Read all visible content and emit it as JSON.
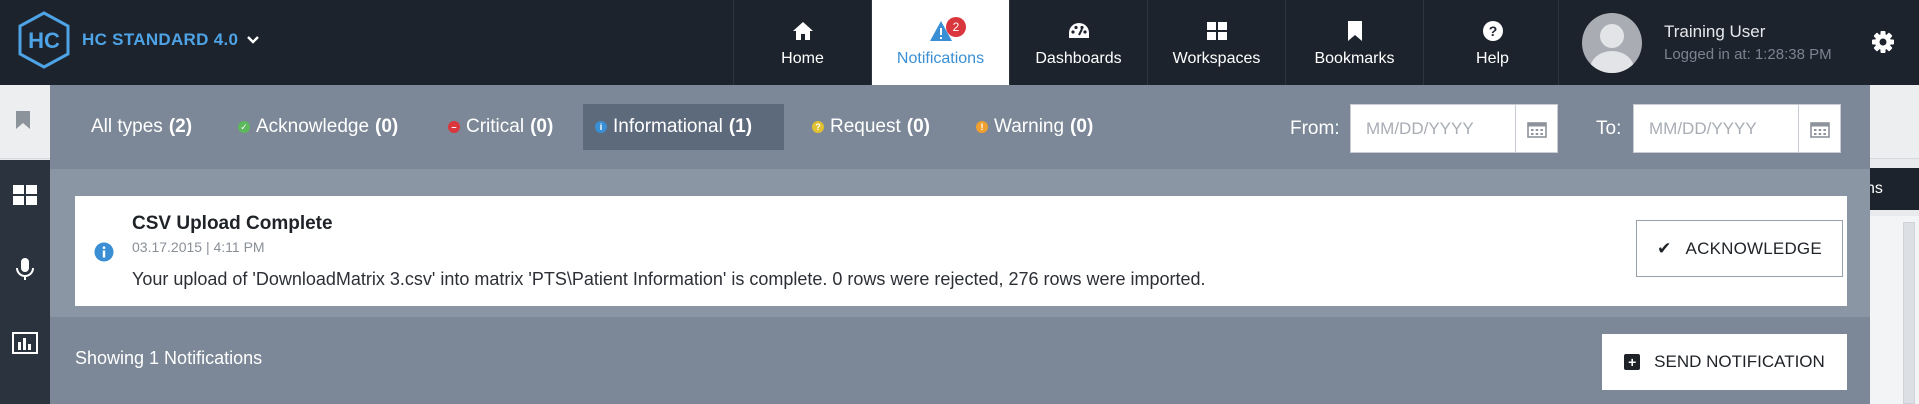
{
  "app": {
    "brand": "HC STANDARD 4.0",
    "logo_text": "HC",
    "brand_dropdown_icon": "chevron-down-icon"
  },
  "nav": {
    "items": [
      {
        "label": "Home",
        "icon": "home-icon"
      },
      {
        "label": "Notifications",
        "icon": "alert-icon",
        "badge": "2",
        "active": true
      },
      {
        "label": "Dashboards",
        "icon": "gauge-icon"
      },
      {
        "label": "Workspaces",
        "icon": "grid-icon"
      },
      {
        "label": "Bookmarks",
        "icon": "bookmark-icon"
      },
      {
        "label": "Help",
        "icon": "question-icon"
      }
    ]
  },
  "user": {
    "name": "Training User",
    "login_text": "Logged in at: 1:28:38 PM",
    "settings_icon": "gear-icon"
  },
  "background": {
    "right_button_label": "ns"
  },
  "filters": [
    {
      "label": "All types",
      "count": "(2)",
      "icon": ""
    },
    {
      "label": "Acknowledge",
      "count": "(0)",
      "icon": "check-circle-icon",
      "color": "#5cb85c"
    },
    {
      "label": "Critical",
      "count": "(0)",
      "icon": "minus-circle-icon",
      "color": "#d9363e"
    },
    {
      "label": "Informational",
      "count": "(1)",
      "icon": "info-circle-icon",
      "color": "#3a8fd4",
      "active": true
    },
    {
      "label": "Request",
      "count": "(0)",
      "icon": "question-circle-icon",
      "color": "#e0c12f"
    },
    {
      "label": "Warning",
      "count": "(0)",
      "icon": "exclamation-circle-icon",
      "color": "#f0a030"
    }
  ],
  "date_filter": {
    "from_label": "From:",
    "to_label": "To:",
    "from_placeholder": "MM/DD/YYYY",
    "to_placeholder": "MM/DD/YYYY",
    "calendar_icon": "calendar-icon"
  },
  "notifications": [
    {
      "type_icon": "info-circle-icon",
      "title": "CSV Upload Complete",
      "meta": "03.17.2015 | 4:11 PM",
      "body": "Your upload of 'DownloadMatrix 3.csv' into matrix 'PTS\\Patient Information' is complete. 0 rows were rejected, 276 rows were imported.",
      "action_label": "ACKNOWLEDGE"
    }
  ],
  "footer": {
    "showing_text": "Showing 1 Notifications",
    "send_label": "SEND NOTIFICATION"
  },
  "colors": {
    "topbar": "#1d232d",
    "accent": "#3a8fd4",
    "panel": "#7c8897",
    "badge": "#d9363e"
  }
}
